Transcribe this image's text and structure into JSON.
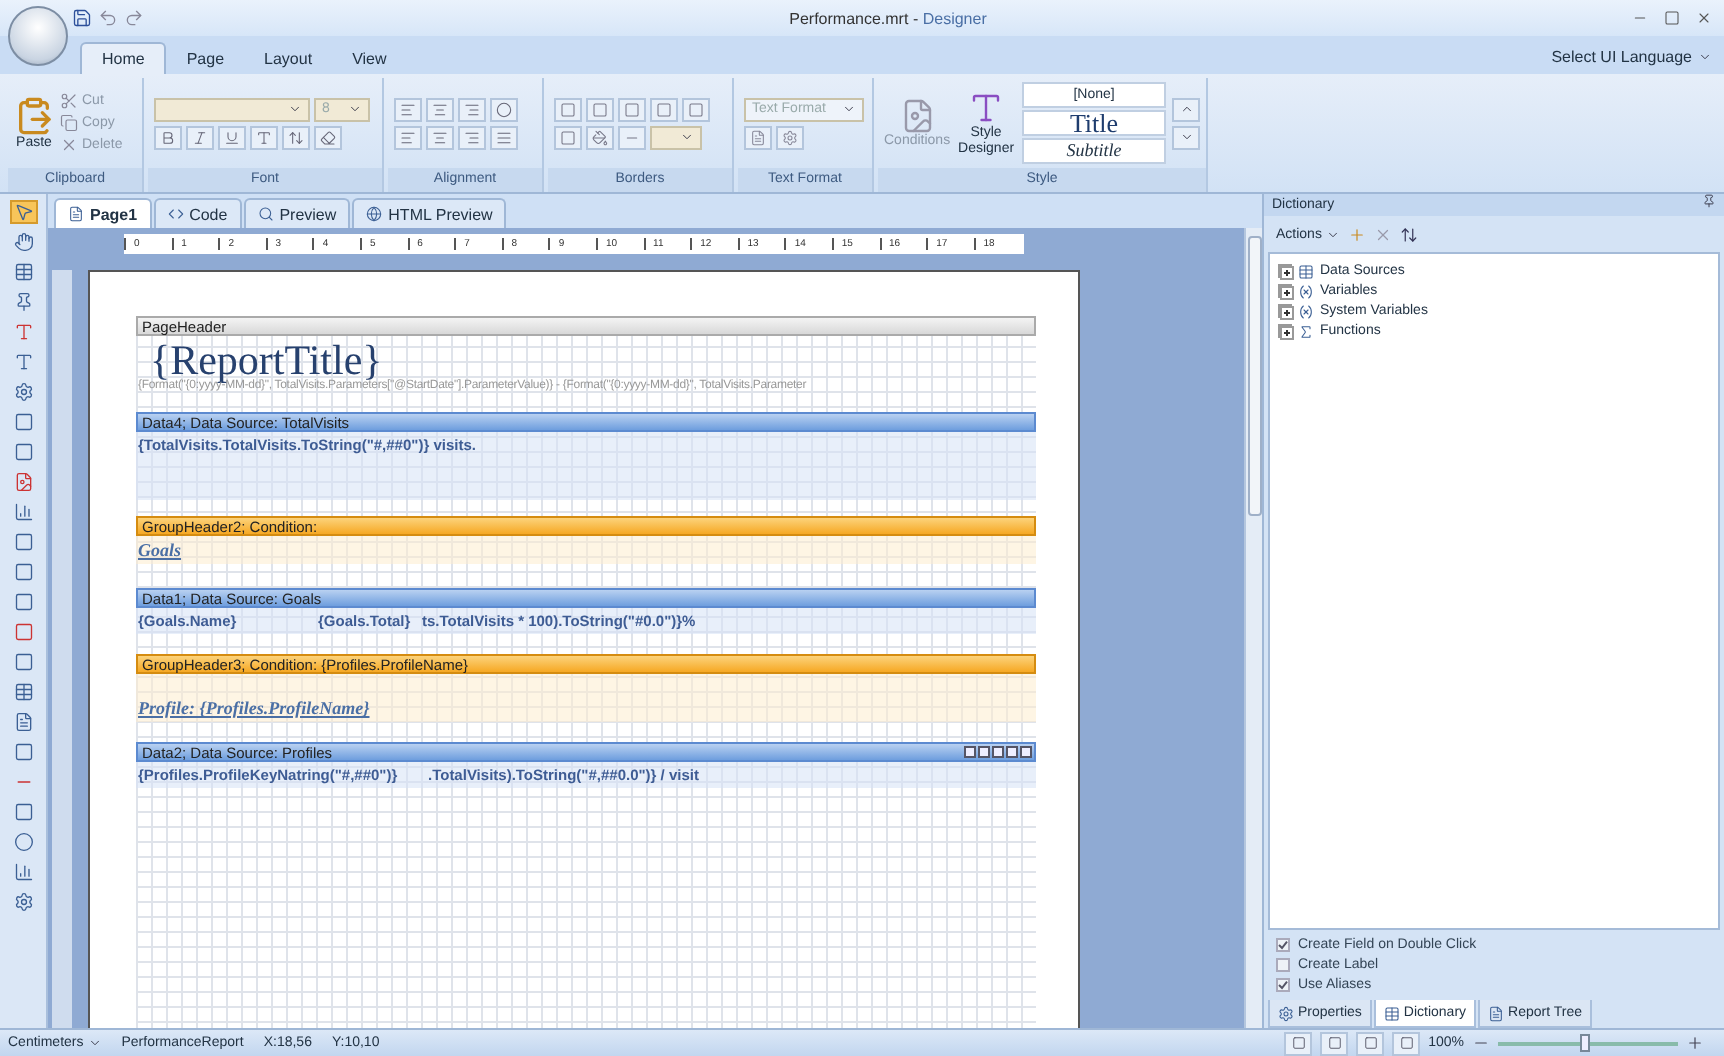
{
  "window": {
    "file": "Performance.mrt",
    "separator": "-",
    "app": "Designer"
  },
  "ribbon": {
    "tabs": [
      {
        "label": "Home",
        "selected": true
      },
      {
        "label": "Page",
        "selected": false
      },
      {
        "label": "Layout",
        "selected": false
      },
      {
        "label": "View",
        "selected": false
      }
    ],
    "language": "Select UI Language",
    "groups": [
      {
        "kind": "clipboard",
        "label": "Clipboard",
        "paste": "Paste",
        "items": [
          {
            "label": "Cut",
            "disabled": true
          },
          {
            "label": "Copy",
            "disabled": true
          },
          {
            "label": "Delete",
            "disabled": true
          }
        ]
      },
      {
        "kind": "font",
        "label": "Font",
        "size": "8"
      },
      {
        "kind": "alignment",
        "label": "Alignment"
      },
      {
        "kind": "borders",
        "label": "Borders"
      },
      {
        "kind": "text_format",
        "label": "Text Format",
        "format": "Text Format"
      },
      {
        "kind": "style",
        "label": "Style",
        "conditions": {
          "label": "Conditions",
          "disabled": true
        },
        "designer": "Style Designer",
        "styles": [
          "[None]",
          "Title",
          "Subtitle"
        ]
      }
    ]
  },
  "doc_tabs": [
    {
      "label": "Page1",
      "selected": true
    },
    {
      "label": "Code",
      "selected": false
    },
    {
      "label": "Preview",
      "selected": false
    },
    {
      "label": "HTML Preview",
      "selected": false
    }
  ],
  "ruler": [
    "0",
    "1",
    "2",
    "3",
    "4",
    "5",
    "6",
    "7",
    "8",
    "9",
    "10",
    "11",
    "12",
    "13",
    "14",
    "15",
    "16",
    "17",
    "18"
  ],
  "bands": [
    {
      "kind": "page",
      "title": "PageHeader",
      "title_text": "{ReportTitle}",
      "expression": "{Format(\"{0:yyyy-MM-dd}\", TotalVisits.Parameters[\"@StartDate\"].ParameterValue)} - {Format(\"{0:yyyy-MM-dd}\", TotalVisits.Parameter"
    },
    {
      "kind": "data",
      "title": "Data4; Data Source: TotalVisits",
      "cells": [
        "{TotalVisits.TotalVisits.ToString(\"#,##0\")} visits."
      ]
    },
    {
      "kind": "group",
      "title": "GroupHeader2; Condition:",
      "heading": "Goals"
    },
    {
      "kind": "data",
      "title": "Data1; Data Source: Goals",
      "cells": [
        "{Goals.Name}",
        "{Goals.Total}",
        "ts.TotalVisits * 100).ToString(\"#0.0\")}%"
      ]
    },
    {
      "kind": "group",
      "title": "GroupHeader3; Condition: {Profiles.ProfileName}",
      "heading": "Profile: {Profiles.ProfileName}"
    },
    {
      "kind": "data",
      "title": "Data2; Data Source: Profiles",
      "selected": true,
      "cells": [
        "{Profiles.ProfileKeyNatring(\"#,##0\")}",
        ".TotalVisits).ToString(\"#,##0.0\")} / visit"
      ]
    }
  ],
  "dictionary": {
    "title": "Dictionary",
    "actions": "Actions",
    "tree": [
      {
        "label": "Data Sources",
        "expanded": false,
        "kind": "datasources"
      },
      {
        "label": "Variables",
        "expanded": false,
        "kind": "variables"
      },
      {
        "label": "System Variables",
        "expanded": false,
        "kind": "variables"
      },
      {
        "label": "Functions",
        "expanded": false,
        "kind": "functions"
      }
    ],
    "options": [
      {
        "label": "Create Field on Double Click",
        "checked": true
      },
      {
        "label": "Create Label",
        "checked": false
      },
      {
        "label": "Use Aliases",
        "checked": true
      }
    ],
    "tabs": [
      {
        "label": "Properties",
        "selected": false
      },
      {
        "label": "Dictionary",
        "selected": true
      },
      {
        "label": "Report Tree",
        "selected": false
      }
    ]
  },
  "status_bar": {
    "units": "Centimeters",
    "report": "PerformanceReport",
    "x": "X:18,56",
    "y": "Y:10,10",
    "zoom": "100%",
    "zoom_slider": {
      "level": 0.45
    }
  }
}
